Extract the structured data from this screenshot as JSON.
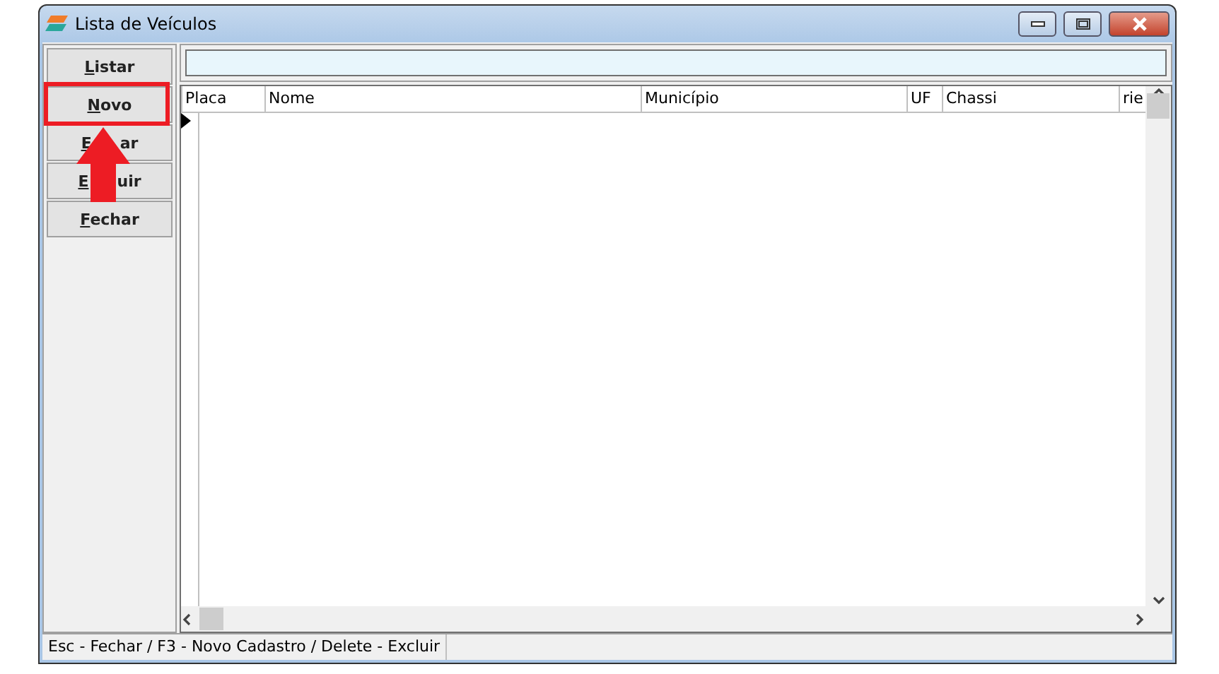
{
  "window": {
    "title": "Lista de Veículos"
  },
  "actions": [
    {
      "label_parts": [
        "Listar"
      ],
      "highlighted": false
    },
    {
      "label_parts": [
        "Novo"
      ],
      "highlighted": true
    },
    {
      "label_parts": [
        "E",
        "ar"
      ],
      "highlighted": false
    },
    {
      "label_parts": [
        "E",
        "uir"
      ],
      "highlighted": false
    },
    {
      "label_parts": [
        "Fechar"
      ],
      "highlighted": false
    }
  ],
  "table": {
    "columns": [
      "Placa",
      "Nome",
      "Município",
      "UF",
      "Chassi",
      "rie"
    ]
  },
  "status_bar": [
    "Esc - Fechar / F3 - Novo Cadastro / Delete - Excluir"
  ]
}
